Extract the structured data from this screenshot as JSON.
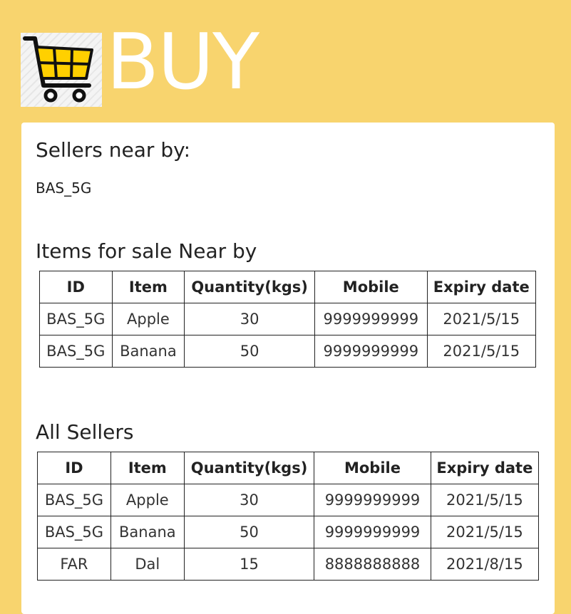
{
  "header": {
    "title": "BUY",
    "logo_icon": "shopping-cart-icon"
  },
  "sellers_near": {
    "heading": "Sellers near by:",
    "seller": "BAS_5G"
  },
  "near_items": {
    "heading": "Items for sale Near by",
    "columns": [
      "ID",
      "Item",
      "Quantity(kgs)",
      "Mobile",
      "Expiry date"
    ],
    "rows": [
      [
        "BAS_5G",
        "Apple",
        "30",
        "9999999999",
        "2021/5/15"
      ],
      [
        "BAS_5G",
        "Banana",
        "50",
        "9999999999",
        "2021/5/15"
      ]
    ]
  },
  "all_sellers": {
    "heading": "All Sellers",
    "columns": [
      "ID",
      "Item",
      "Quantity(kgs)",
      "Mobile",
      "Expiry date"
    ],
    "rows": [
      [
        "BAS_5G",
        "Apple",
        "30",
        "9999999999",
        "2021/5/15"
      ],
      [
        "BAS_5G",
        "Banana",
        "50",
        "9999999999",
        "2021/5/15"
      ],
      [
        "FAR",
        "Dal",
        "15",
        "8888888888",
        "2021/8/15"
      ]
    ]
  },
  "colors": {
    "background": "#f8d46e",
    "cart_fill": "#ffd000",
    "title": "#ffffff"
  }
}
